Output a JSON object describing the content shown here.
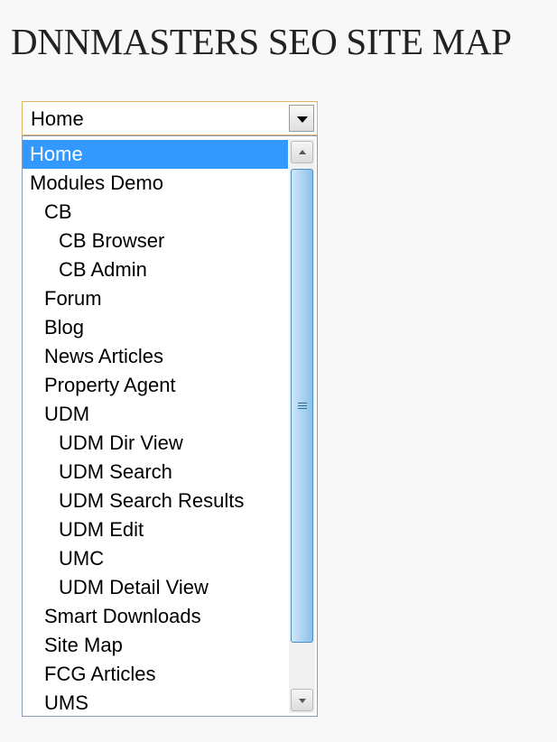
{
  "page": {
    "title": "DNNMASTERS SEO SITE MAP"
  },
  "dropdown": {
    "selected_value": "Home",
    "icons": {
      "button": "chevron-down-icon",
      "scroll_up": "scroll-up-arrow-icon",
      "scroll_down": "scroll-down-arrow-icon",
      "thumb_grip": "scroll-thumb-grip-icon"
    },
    "options": [
      {
        "label": "Home",
        "depth": 0,
        "selected": true
      },
      {
        "label": "Modules Demo",
        "depth": 0
      },
      {
        "label": "CB",
        "depth": 1
      },
      {
        "label": "CB Browser",
        "depth": 2
      },
      {
        "label": "CB Admin",
        "depth": 2
      },
      {
        "label": "Forum",
        "depth": 1
      },
      {
        "label": "Blog",
        "depth": 1
      },
      {
        "label": "News Articles",
        "depth": 1
      },
      {
        "label": "Property Agent",
        "depth": 1
      },
      {
        "label": "UDM",
        "depth": 1
      },
      {
        "label": "UDM Dir View",
        "depth": 2
      },
      {
        "label": "UDM Search",
        "depth": 2
      },
      {
        "label": "UDM Search Results",
        "depth": 2
      },
      {
        "label": "UDM Edit",
        "depth": 2
      },
      {
        "label": "UMC",
        "depth": 2
      },
      {
        "label": "UDM Detail View",
        "depth": 2
      },
      {
        "label": "Smart Downloads",
        "depth": 1
      },
      {
        "label": "Site Map",
        "depth": 1
      },
      {
        "label": "FCG Articles",
        "depth": 1
      },
      {
        "label": "UMS",
        "depth": 1
      }
    ]
  },
  "colors": {
    "selected_background": "#3399ff",
    "selected_text": "#ffffff",
    "combo_border": "#e0b561",
    "scroll_thumb": "#a9d2f1"
  }
}
